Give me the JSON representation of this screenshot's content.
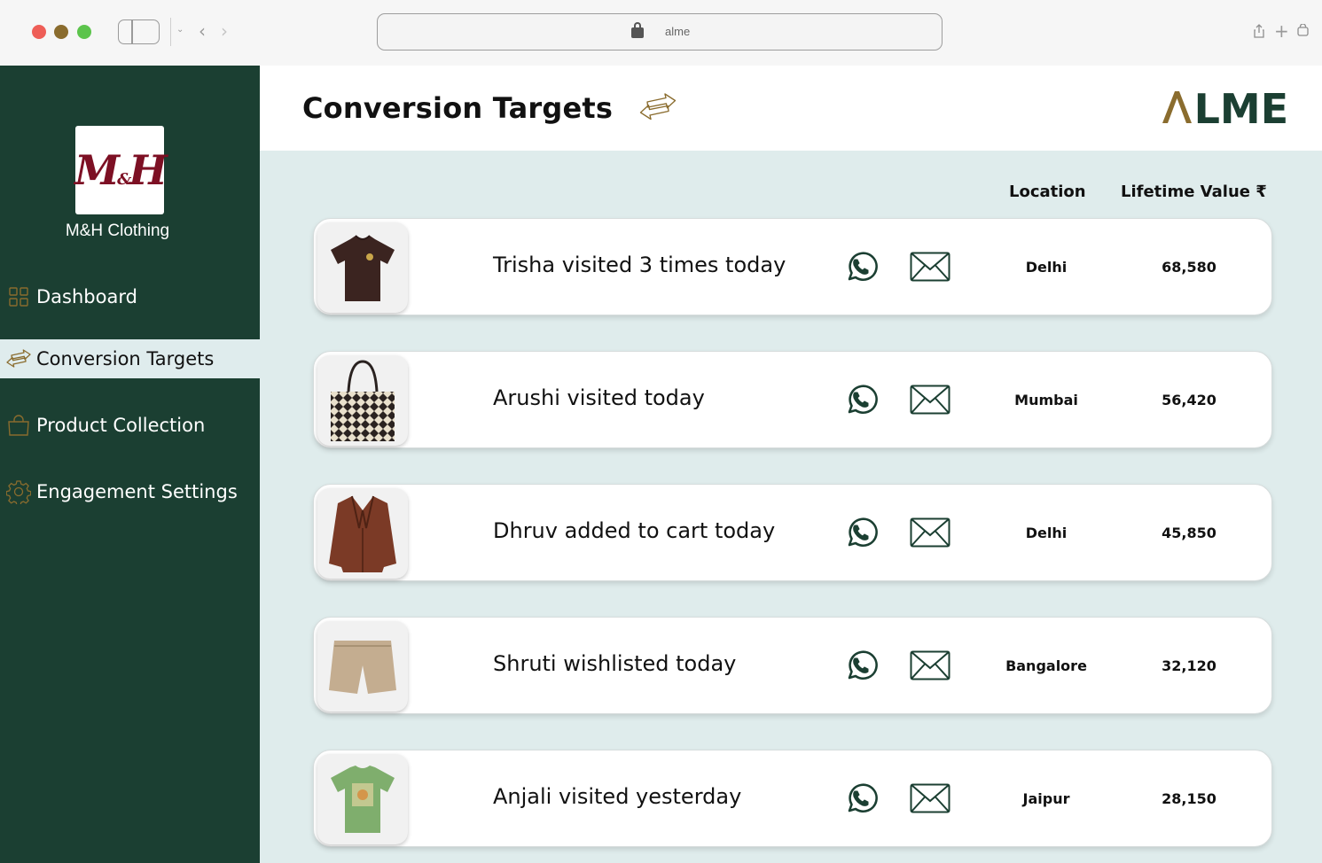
{
  "browser": {
    "address": "alme"
  },
  "sidebar": {
    "brand_name": "M&H Clothing",
    "logo_text_main": "M",
    "logo_text_amp": "&",
    "logo_text_end": "H",
    "items": [
      {
        "label": "Dashboard",
        "icon": "grid-icon",
        "active": false
      },
      {
        "label": "Conversion Targets",
        "icon": "swap-arrows-icon",
        "active": true
      },
      {
        "label": "Product Collection",
        "icon": "shopping-bag-icon",
        "active": false
      },
      {
        "label": "Engagement Settings",
        "icon": "gear-icon",
        "active": false
      }
    ]
  },
  "header": {
    "title": "Conversion Targets",
    "logo": "ALME"
  },
  "table": {
    "col_location": "Location",
    "col_ltv": "Lifetime Value ₹",
    "rows": [
      {
        "text": "Trisha visited 3 times today",
        "location": "Delhi",
        "ltv": "68,580",
        "product": "brown-tshirt"
      },
      {
        "text": "Arushi visited today",
        "location": "Mumbai",
        "ltv": "56,420",
        "product": "tote-bag"
      },
      {
        "text": "Dhruv added to cart today",
        "location": "Delhi",
        "ltv": "45,850",
        "product": "brown-blazer"
      },
      {
        "text": "Shruti wishlisted today",
        "location": "Bangalore",
        "ltv": "32,120",
        "product": "beige-shorts"
      },
      {
        "text": "Anjali visited yesterday",
        "location": "Jaipur",
        "ltv": "28,150",
        "product": "green-tshirt"
      }
    ]
  },
  "colors": {
    "sidebar_bg": "#1b3f32",
    "content_bg": "#dfecec",
    "accent_gold": "#8a6c2e",
    "brand_red": "#7d1024"
  }
}
